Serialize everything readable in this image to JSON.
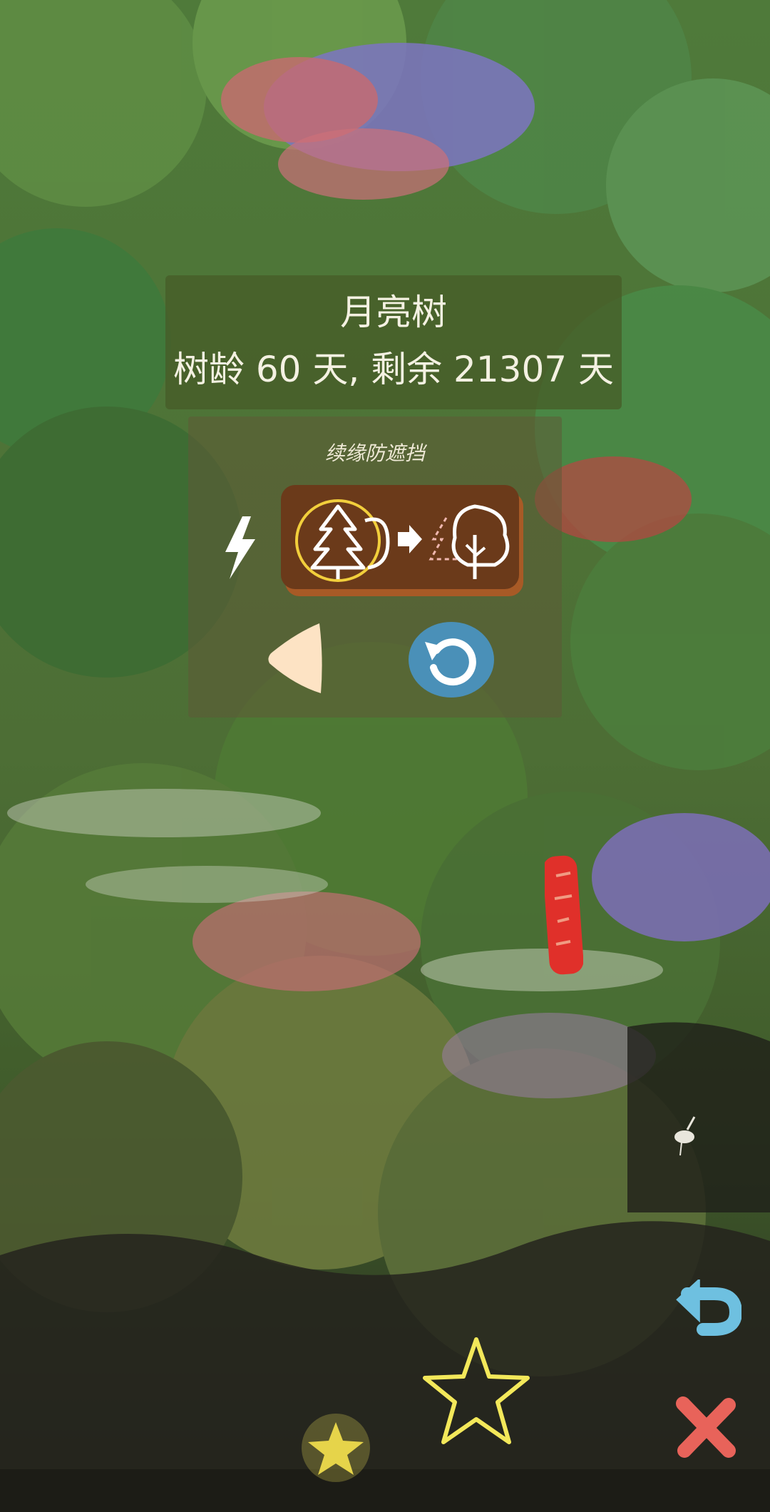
{
  "tree_info": {
    "name": "月亮树",
    "age_text": "树龄 60 天, 剩余 21307 天"
  },
  "tool_panel": {
    "title": "续缘防遮挡"
  },
  "icons": {
    "lightning": "lightning-icon",
    "tree_swap": "tree-transform-icon",
    "prev": "triangle-left-icon",
    "refresh": "refresh-icon",
    "undo": "undo-arrow-icon",
    "star": "star-icon",
    "close": "close-x-icon",
    "seal": "red-seal-icon"
  },
  "colors": {
    "panel_bg": "#465c28",
    "button_brown": "#6b3a1a",
    "refresh_blue": "#4a90b8",
    "star_yellow": "#f3e85a",
    "close_red": "#e8635a",
    "undo_blue": "#6ec0e0",
    "seal_red": "#e0302a"
  }
}
